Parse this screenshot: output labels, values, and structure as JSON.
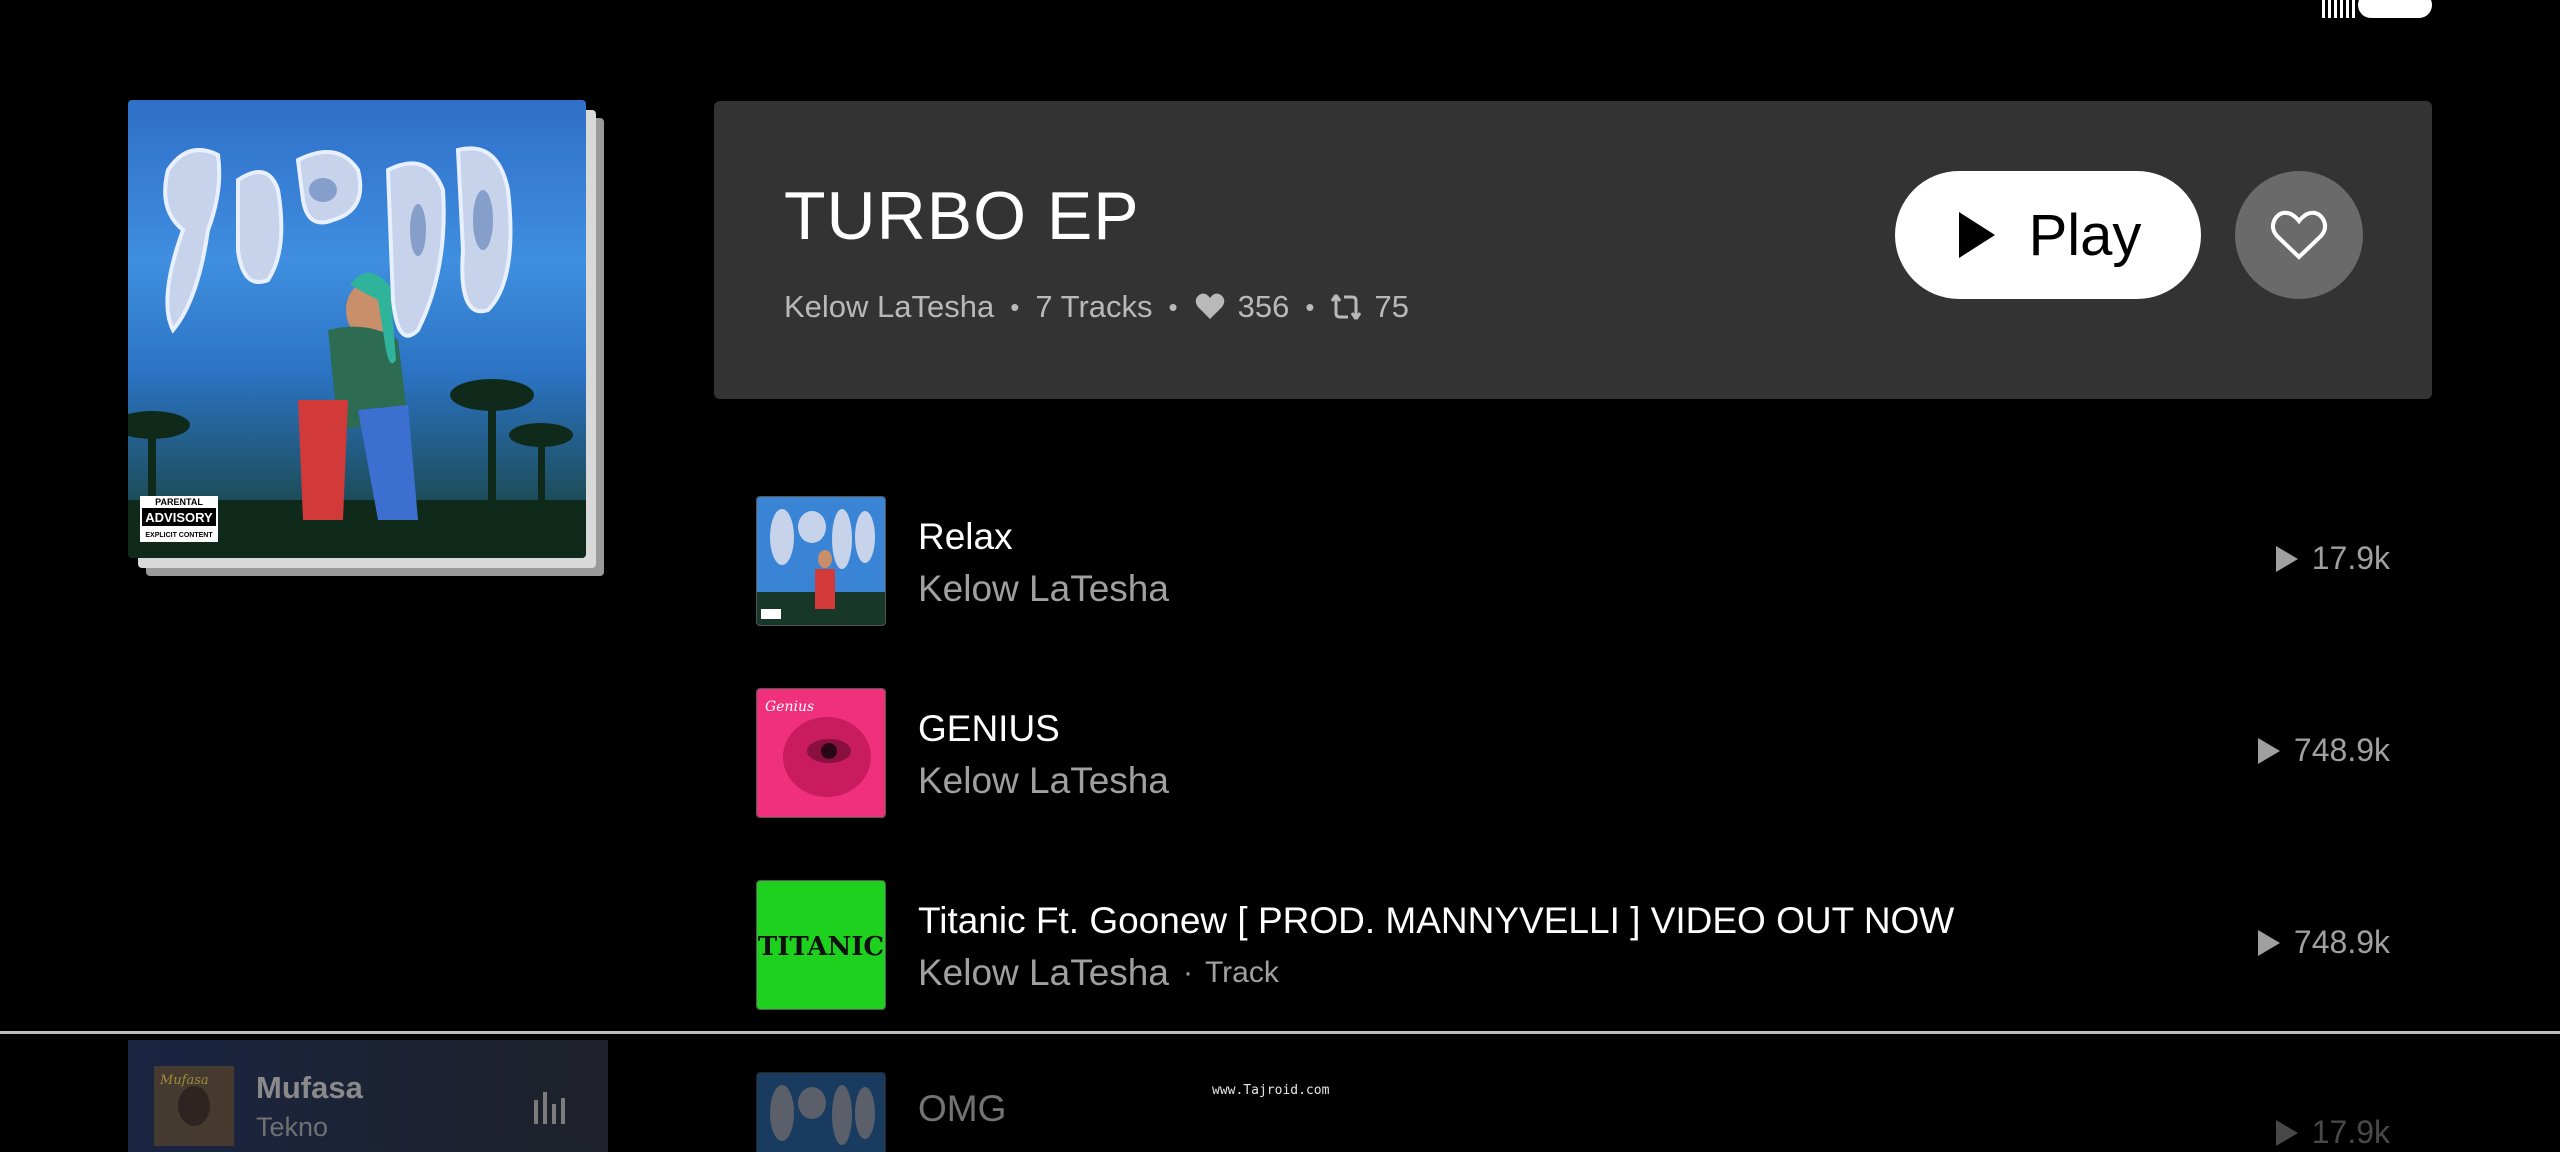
{
  "album": {
    "title": "TURBO EP",
    "artist": "Kelow LaTesha",
    "tracks_count": "7 Tracks",
    "likes": "356",
    "reposts": "75",
    "art_text": "TURBO",
    "advisory": {
      "line1": "PARENTAL",
      "line2": "ADVISORY",
      "line3": "EXPLICIT CONTENT"
    }
  },
  "actions": {
    "play_label": "Play",
    "like_icon": "heart-outline-icon",
    "play_icon": "play-icon"
  },
  "tracks": [
    {
      "title": "Relax",
      "artist": "Kelow LaTesha",
      "plays": "17.9k",
      "type": "",
      "thumb": "turbo-art"
    },
    {
      "title": "GENIUS",
      "artist": "Kelow LaTesha",
      "plays": "748.9k",
      "type": "",
      "thumb": "genius-art"
    },
    {
      "title": "Titanic Ft. Goonew [ PROD. MANNYVELLI ] VIDEO OUT NOW",
      "artist": "Kelow LaTesha",
      "plays": "748.9k",
      "type": "Track",
      "thumb": "titanic-art"
    },
    {
      "title": "OMG",
      "artist": "",
      "plays": "17.9k",
      "type": "",
      "thumb": "turbo-art"
    }
  ],
  "thumb_text": {
    "genius": "Genius",
    "titanic": "TITANIC"
  },
  "now_playing": {
    "title": "Mufasa",
    "artist": "Tekno",
    "thumb_text": "Mufasa"
  },
  "watermark": "www.Tajroid.com",
  "colors": {
    "background": "#000000",
    "card": "#333333",
    "secondary_text": "#a0a0a0",
    "titanic_green": "#1fd11f",
    "genius_pink": "#f0307a"
  }
}
